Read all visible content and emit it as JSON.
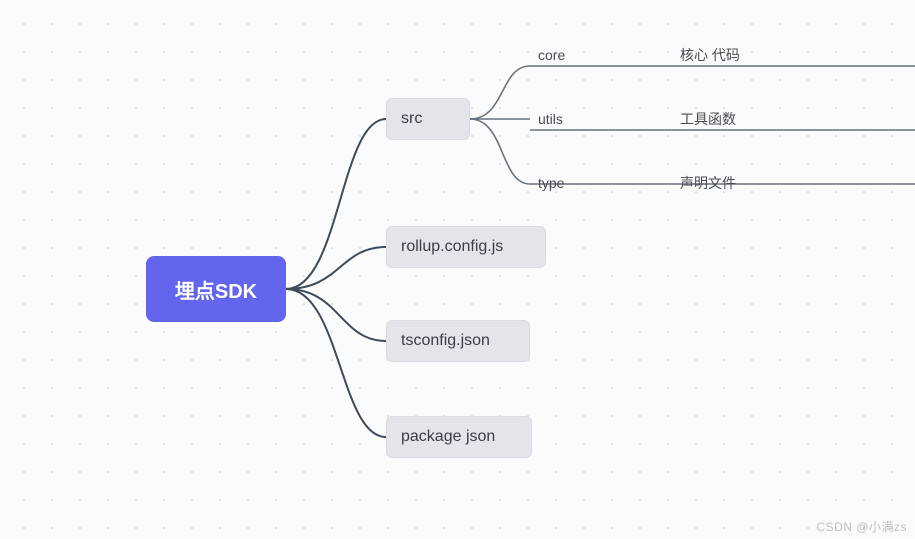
{
  "root": {
    "label": "埋点SDK"
  },
  "branches": {
    "src": "src",
    "rollup": "rollup.config.js",
    "tsconfig": "tsconfig.json",
    "package": "package json"
  },
  "src_children": {
    "core": {
      "name": "core",
      "desc": "核心 代码"
    },
    "utils": {
      "name": "utils",
      "desc": "工具函数"
    },
    "type": {
      "name": "type",
      "desc": "声明文件"
    }
  },
  "watermark": "CSDN @小满zs",
  "colors": {
    "root_bg": "#6366ec",
    "branch_bg": "#e3e5ea",
    "connector": "#3f4a5a",
    "underline": "#6b7280"
  }
}
